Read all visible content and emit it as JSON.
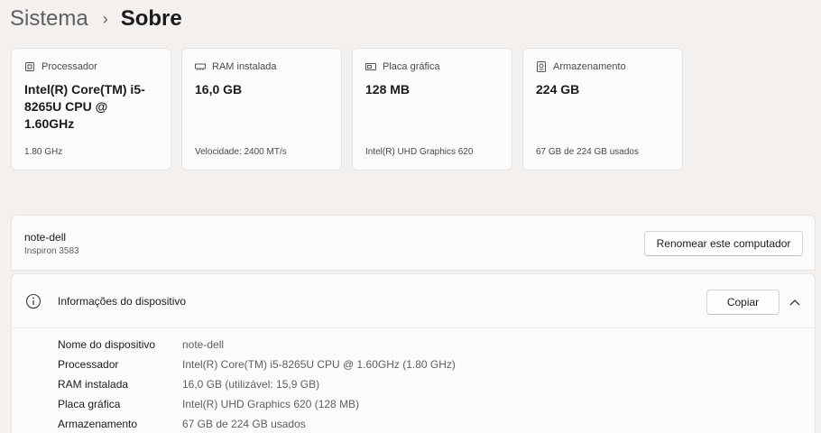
{
  "breadcrumb": {
    "parent": "Sistema",
    "separator": "›",
    "current": "Sobre"
  },
  "cards": [
    {
      "icon": "processor-icon",
      "title": "Processador",
      "value": "Intel(R) Core(TM) i5-8265U CPU @ 1.60GHz",
      "footer": "1.80 GHz"
    },
    {
      "icon": "ram-icon",
      "title": "RAM instalada",
      "value": "16,0 GB",
      "footer": "Velocidade: 2400 MT/s"
    },
    {
      "icon": "graphics-card-icon",
      "title": "Placa gráfica",
      "value": "128 MB",
      "footer": "Intel(R) UHD Graphics 620"
    },
    {
      "icon": "storage-icon",
      "title": "Armazenamento",
      "value": "224 GB",
      "footer": "67 GB de 224 GB usados"
    }
  ],
  "device": {
    "name": "note-dell",
    "model": "Inspiron 3583",
    "rename_label": "Renomear este computador"
  },
  "info": {
    "title": "Informações do dispositivo",
    "copy_label": "Copiar",
    "rows": [
      {
        "label": "Nome do dispositivo",
        "value": "note-dell"
      },
      {
        "label": "Processador",
        "value": "Intel(R) Core(TM) i5-8265U CPU @ 1.60GHz (1.80 GHz)"
      },
      {
        "label": "RAM instalada",
        "value": "16,0 GB (utilizável: 15,9 GB)"
      },
      {
        "label": "Placa gráfica",
        "value": "Intel(R) UHD Graphics 620 (128 MB)"
      },
      {
        "label": "Armazenamento",
        "value": "67 GB de 224 GB usados"
      }
    ]
  }
}
